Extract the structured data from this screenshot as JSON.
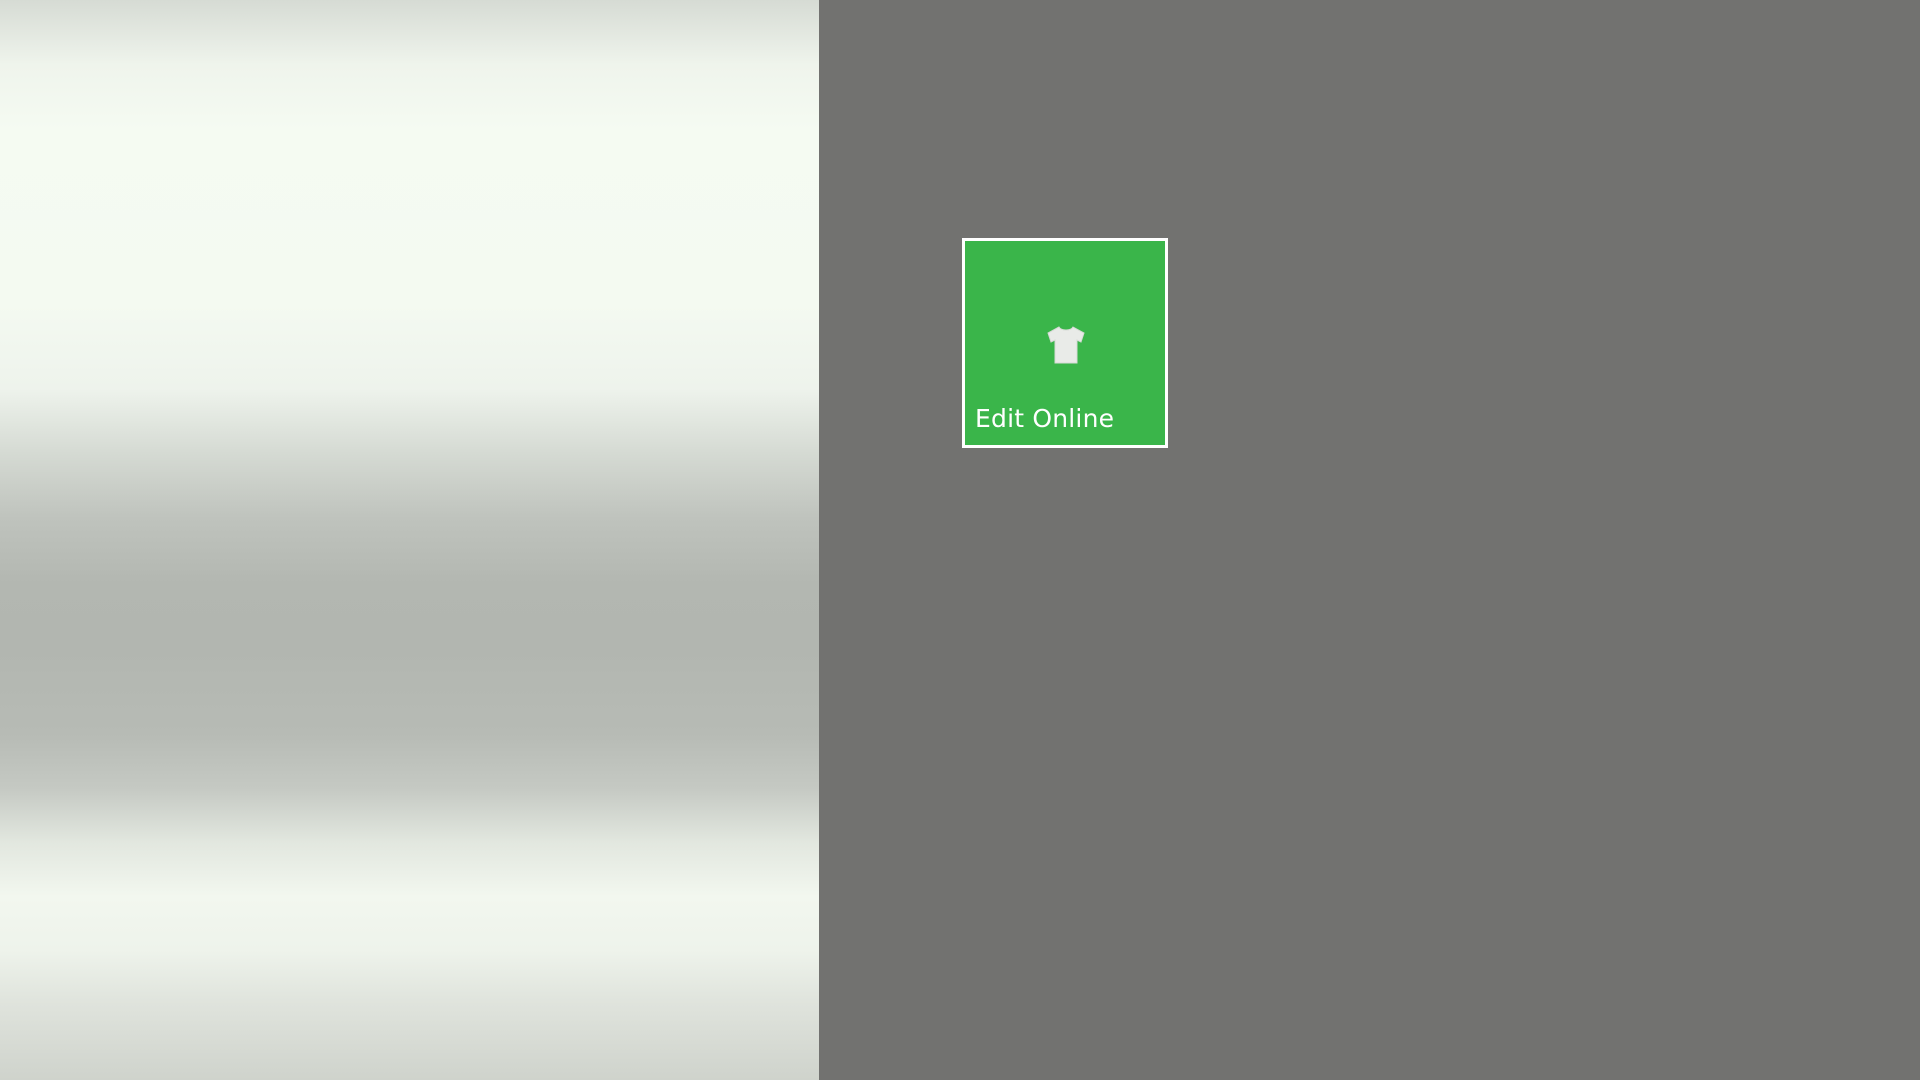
{
  "tiles": [
    {
      "label": "Edit Online",
      "icon": "tshirt-icon",
      "color": "#3ab54a"
    }
  ],
  "colors": {
    "background": "#727270",
    "tile_border": "#ffffff"
  }
}
